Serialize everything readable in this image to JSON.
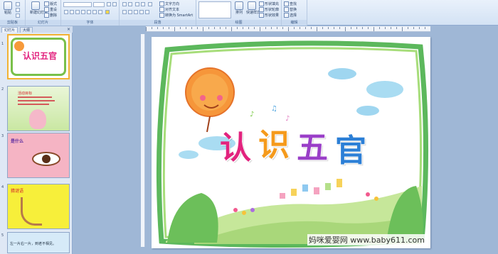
{
  "ribbon": {
    "groups": [
      "剪贴板",
      "幻灯片",
      "字体",
      "段落",
      "绘图",
      "编辑"
    ],
    "paste_label": "粘贴",
    "new_slide_label": "新建幻灯片",
    "layout_label": "版式",
    "reset_label": "重设",
    "delete_label": "删除",
    "text_direction_label": "文字方向",
    "align_text_label": "对齐文本",
    "smartart_label": "转换为 SmartArt",
    "arrange_label": "排列",
    "quick_styles_label": "快速样式",
    "shape_fill_label": "形状填充",
    "shape_outline_label": "形状轮廓",
    "shape_effects_label": "形状效果",
    "find_label": "查找",
    "replace_label": "替换",
    "select_label": "选择"
  },
  "pane": {
    "tab_slides": "幻灯片",
    "tab_outline": "大纲",
    "thumbs": [
      {
        "num": "1",
        "text": "认识五官"
      },
      {
        "num": "2",
        "text": "活动目标"
      },
      {
        "num": "3",
        "text": "是什么"
      },
      {
        "num": "4",
        "text": "猜谜语"
      },
      {
        "num": "5",
        "text": "左一片右一片，到老不相见。"
      }
    ]
  },
  "slide": {
    "title": [
      "认",
      "识",
      "五",
      "官"
    ],
    "title_colors": [
      "#e2237e",
      "#f59a1c",
      "#9a3fc8",
      "#2c7fd6"
    ]
  },
  "watermark": "妈咪爱婴网 www.baby611.com"
}
